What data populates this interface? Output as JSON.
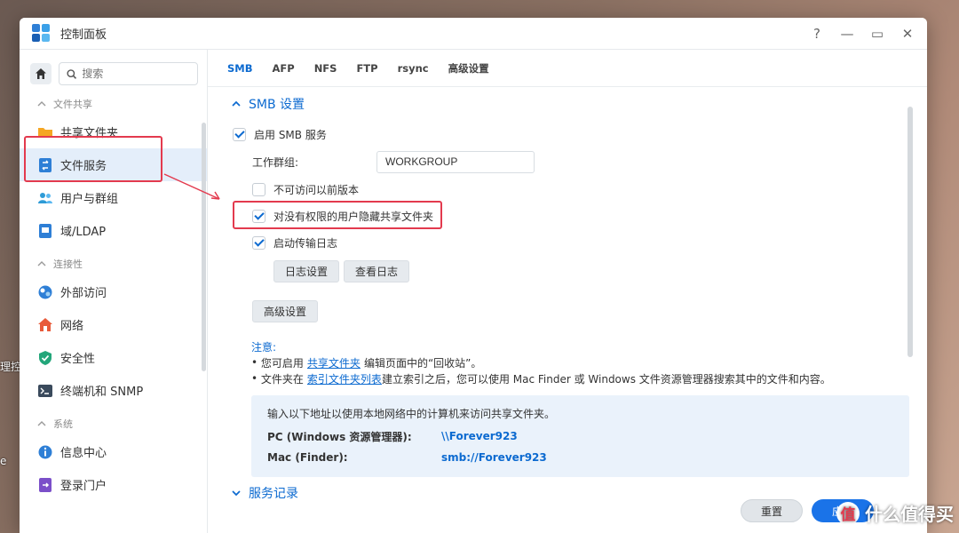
{
  "background": {
    "edge_text_1": "理控",
    "edge_text_2": "e"
  },
  "window": {
    "title": "控制面板",
    "controls": {
      "help": "?",
      "minimize": "—",
      "maximize": "▭",
      "close": "✕"
    }
  },
  "sidebar": {
    "search_placeholder": "搜索",
    "groups": [
      {
        "title": "文件共享",
        "items": [
          {
            "label": "共享文件夹",
            "icon": "folder-icon"
          },
          {
            "label": "文件服务",
            "icon": "file-services-icon",
            "active": true
          },
          {
            "label": "用户与群组",
            "icon": "users-icon"
          },
          {
            "label": "域/LDAP",
            "icon": "ldap-icon"
          }
        ]
      },
      {
        "title": "连接性",
        "items": [
          {
            "label": "外部访问",
            "icon": "external-access-icon"
          },
          {
            "label": "网络",
            "icon": "network-home-icon"
          },
          {
            "label": "安全性",
            "icon": "shield-icon"
          },
          {
            "label": "终端机和 SNMP",
            "icon": "terminal-icon"
          }
        ]
      },
      {
        "title": "系统",
        "items": [
          {
            "label": "信息中心",
            "icon": "info-icon"
          },
          {
            "label": "登录门户",
            "icon": "login-portal-icon"
          }
        ]
      }
    ]
  },
  "tabs": [
    "SMB",
    "AFP",
    "NFS",
    "FTP",
    "rsync",
    "高级设置"
  ],
  "active_tab": "SMB",
  "smb": {
    "section_title": "SMB 设置",
    "enable_label": "启用 SMB 服务",
    "enable_checked": true,
    "workgroup_label": "工作群组:",
    "workgroup_value": "WORKGROUP",
    "prev_versions_label": "不可访问以前版本",
    "prev_versions_checked": false,
    "hide_label": "对没有权限的用户隐藏共享文件夹",
    "hide_checked": true,
    "log_label": "启动传输日志",
    "log_checked": true,
    "log_settings_btn": "日志设置",
    "view_log_btn": "查看日志",
    "advanced_btn": "高级设置",
    "note_title": "注意:",
    "note1_pre": "您可启用",
    "note1_link": "共享文件夹",
    "note1_post": "编辑页面中的“回收站”。",
    "note2_pre": "文件夹在",
    "note2_link": "索引文件夹列表",
    "note2_post": "建立索引之后，您可以使用 Mac Finder 或 Windows 文件资源管理器搜索其中的文件和内容。",
    "info_intro": "输入以下地址以使用本地网络中的计算机来访问共享文件夹。",
    "pc_label": "PC (Windows 资源管理器):",
    "pc_value": "\\\\Forever923",
    "mac_label": "Mac (Finder):",
    "mac_value": "smb://Forever923",
    "next_section": "服务记录"
  },
  "footer": {
    "reset": "重置",
    "apply": "应用"
  },
  "watermark": {
    "logo": "值",
    "text": "什么值得买"
  },
  "colors": {
    "accent": "#0c6ad0",
    "highlight": "#e33a4e",
    "active_bg": "#e4eefa"
  }
}
